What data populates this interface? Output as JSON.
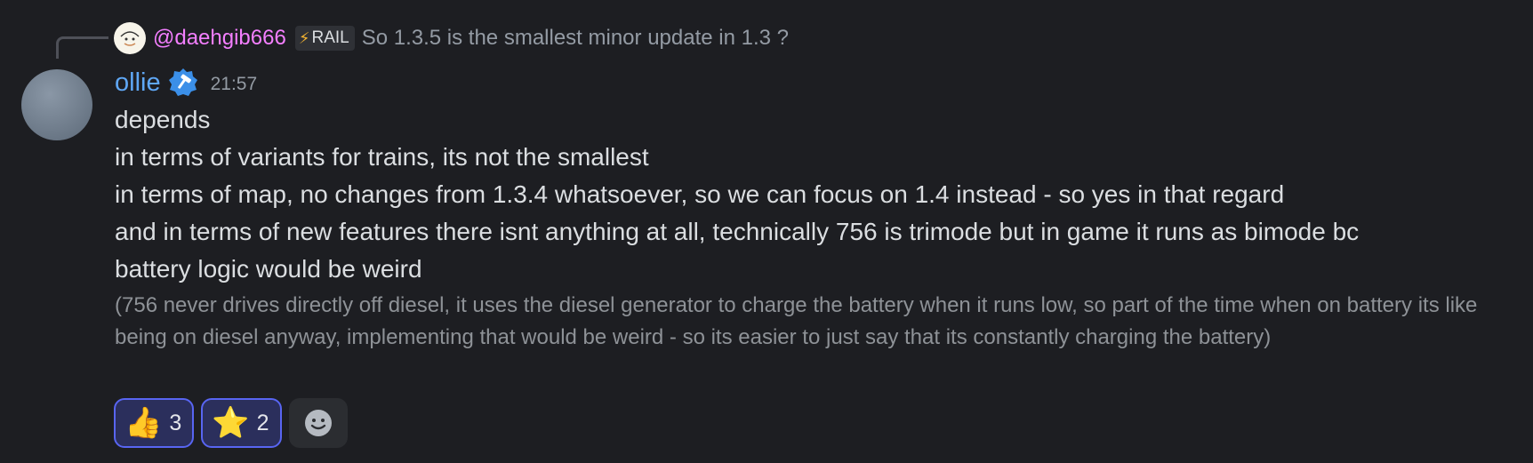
{
  "reply": {
    "author": "@daehgib666",
    "tag": "RAIL",
    "text": "So 1.3.5 is the smallest minor update in 1.3 ?"
  },
  "message": {
    "author": "ollie",
    "timestamp": "21:57",
    "lines": [
      "depends",
      "in terms of variants for trains, its not the smallest",
      "in terms of map, no changes from 1.3.4 whatsoever, so we can focus on 1.4 instead - so yes in that regard",
      "and in terms of new features there isnt anything at all, technically 756 is trimode but in game it runs as bimode bc",
      "battery logic would be weird"
    ],
    "note": "(756 never drives directly off diesel, it uses the diesel generator to charge the battery when it runs low, so part of the time when on battery its like being on diesel anyway, implementing that would be weird - so its easier to just say that its constantly charging the battery)"
  },
  "reactions": [
    {
      "emoji": "👍",
      "count": "3",
      "icon": "thumbs-up-icon"
    },
    {
      "emoji": "⭐",
      "count": "2",
      "icon": "star-icon"
    }
  ],
  "icons": {
    "add_reaction": "smiley-face-icon",
    "verified": "verified-badge-hammer-icon",
    "tag": "lightning-bolt-icon"
  },
  "colors": {
    "background": "#1d1e22",
    "author": "#5fa7f5",
    "reply_author": "#f47fff",
    "reaction_active_border": "#5865f2"
  }
}
